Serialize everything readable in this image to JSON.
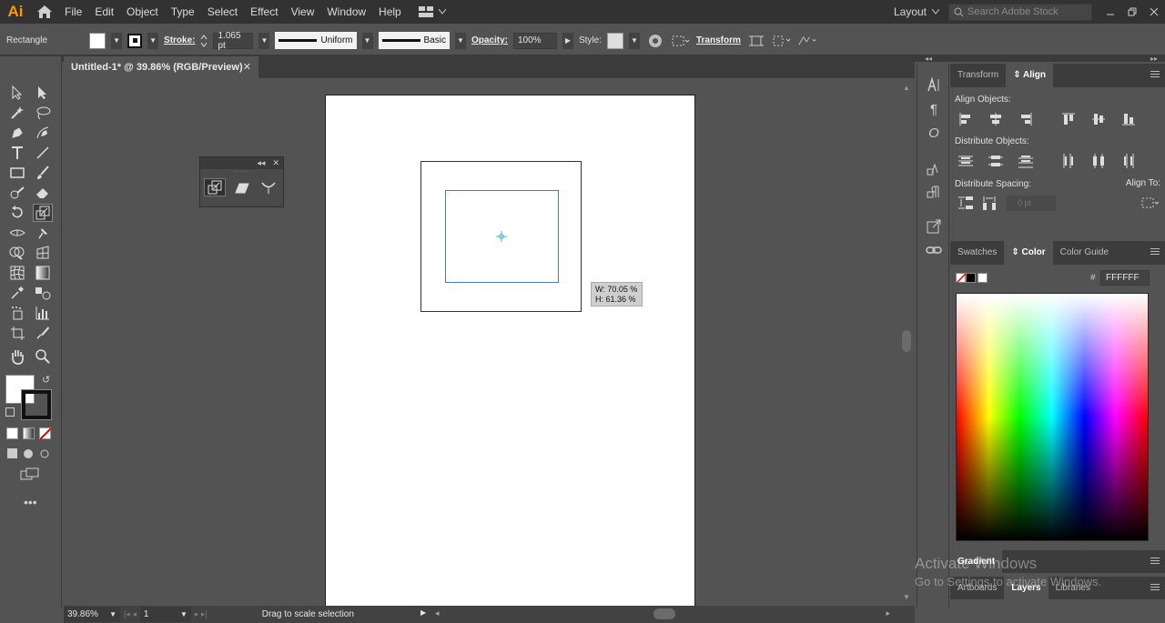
{
  "app": {
    "logo": "Ai"
  },
  "menu": [
    "File",
    "Edit",
    "Object",
    "Type",
    "Select",
    "Effect",
    "View",
    "Window",
    "Help"
  ],
  "workspace": {
    "label": "Layout"
  },
  "search": {
    "placeholder": "Search Adobe Stock"
  },
  "control": {
    "tool_name": "Rectangle",
    "stroke_label": "Stroke:",
    "stroke_weight": "1.065 pt",
    "profile": "Uniform",
    "brush": "Basic",
    "opacity_label": "Opacity:",
    "opacity": "100%",
    "style_label": "Style:",
    "transform_label": "Transform"
  },
  "document": {
    "tab_title": "Untitled-1* @ 39.86% (RGB/Preview)"
  },
  "selection": {
    "width_readout": "W: 70.05 %",
    "height_readout": "H: 61.36 %"
  },
  "status": {
    "zoom": "39.86%",
    "artboard": "1",
    "message": "Drag to scale selection"
  },
  "align_panel": {
    "tabs": [
      "Transform",
      "Align"
    ],
    "active_tab": "Align",
    "align_objects": "Align Objects:",
    "distribute_objects": "Distribute Objects:",
    "distribute_spacing": "Distribute Spacing:",
    "align_to": "Align To:",
    "spacing_value": "0 pt"
  },
  "color_panel": {
    "tabs": [
      "Swatches",
      "Color",
      "Color Guide"
    ],
    "active_tab": "Color",
    "hash": "#",
    "hex": "FFFFFF"
  },
  "gradient_panel": {
    "tab": "Gradient"
  },
  "layers_panel": {
    "tabs": [
      "Artboards",
      "Layers",
      "Libraries"
    ],
    "active_tab": "Layers"
  },
  "watermark": {
    "title": "Activate Windows",
    "subtitle": "Go to Settings to activate Windows."
  },
  "colors": {
    "accent": "#ff9a00",
    "selection": "#4a7ac8",
    "chrome_dark": "#323232",
    "chrome": "#535353"
  }
}
